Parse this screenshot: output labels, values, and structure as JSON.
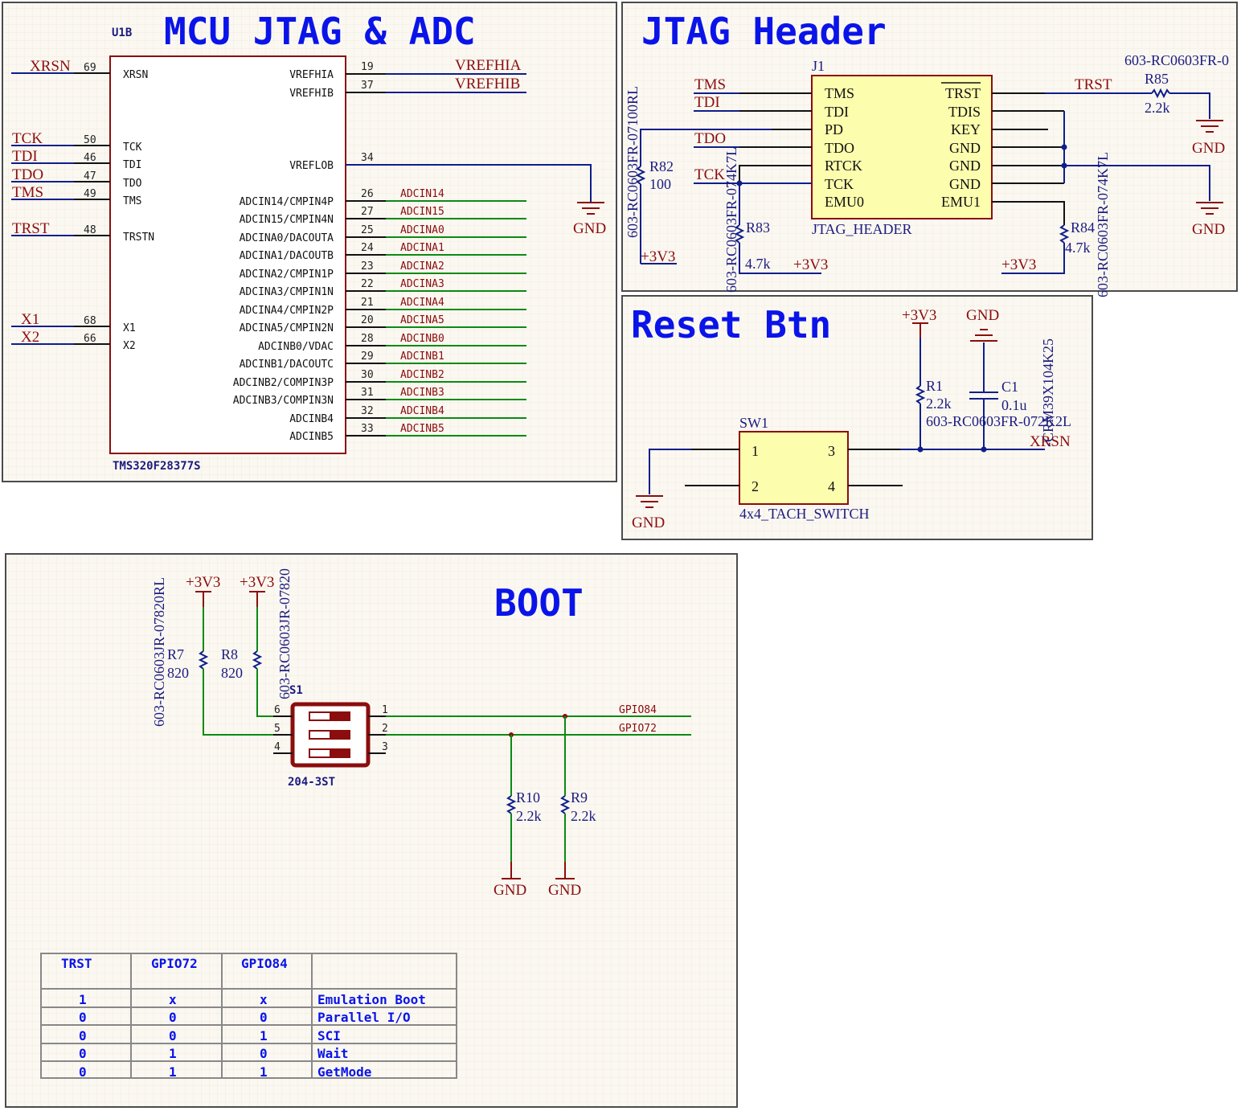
{
  "mcu_panel": {
    "title": "MCU JTAG & ADC",
    "ref": "U1B",
    "part": "TMS320F28377S",
    "left_pins": [
      {
        "net": "XRSN",
        "num": "69",
        "name": "XRSN"
      },
      {
        "net": "TCK",
        "num": "50",
        "name": "TCK"
      },
      {
        "net": "TDI",
        "num": "46",
        "name": "TDI"
      },
      {
        "net": "TDO",
        "num": "47",
        "name": "TDO"
      },
      {
        "net": "TMS",
        "num": "49",
        "name": "TMS"
      },
      {
        "net": "TRST",
        "num": "48",
        "name": "TRSTN"
      },
      {
        "net": "X1",
        "num": "68",
        "name": "X1"
      },
      {
        "net": "X2",
        "num": "66",
        "name": "X2"
      }
    ],
    "right_pins": [
      {
        "name": "VREFHIA",
        "num": "19",
        "net": "VREFHIA"
      },
      {
        "name": "VREFHIB",
        "num": "37",
        "net": "VREFHIB"
      },
      {
        "name": "VREFLOB",
        "num": "34",
        "net": ""
      },
      {
        "name": "ADCIN14/CMPIN4P",
        "num": "26",
        "net": "ADCIN14"
      },
      {
        "name": "ADCIN15/CMPIN4N",
        "num": "27",
        "net": "ADCIN15"
      },
      {
        "name": "ADCINA0/DACOUTA",
        "num": "25",
        "net": "ADCINA0"
      },
      {
        "name": "ADCINA1/DACOUTB",
        "num": "24",
        "net": "ADCINA1"
      },
      {
        "name": "ADCINA2/CMPIN1P",
        "num": "23",
        "net": "ADCINA2"
      },
      {
        "name": "ADCINA3/CMPIN1N",
        "num": "22",
        "net": "ADCINA3"
      },
      {
        "name": "ADCINA4/CMPIN2P",
        "num": "21",
        "net": "ADCINA4"
      },
      {
        "name": "ADCINA5/CMPIN2N",
        "num": "20",
        "net": "ADCINA5"
      },
      {
        "name": "ADCINB0/VDAC",
        "num": "28",
        "net": "ADCINB0"
      },
      {
        "name": "ADCINB1/DACOUTC",
        "num": "29",
        "net": "ADCINB1"
      },
      {
        "name": "ADCINB2/COMPIN3P",
        "num": "30",
        "net": "ADCINB2"
      },
      {
        "name": "ADCINB3/COMPIN3N",
        "num": "31",
        "net": "ADCINB3"
      },
      {
        "name": "ADCINB4",
        "num": "32",
        "net": "ADCINB4"
      },
      {
        "name": "ADCINB5",
        "num": "33",
        "net": "ADCINB5"
      }
    ],
    "gnd": "GND"
  },
  "jtag_panel": {
    "title": "JTAG Header",
    "ref": "J1",
    "part": "JTAG_HEADER",
    "left_pins": [
      "TMS",
      "TDI",
      "PD",
      "TDO",
      "RTCK",
      "TCK",
      "EMU0"
    ],
    "right_pins": [
      "TRST",
      "TDIS",
      "KEY",
      "GND",
      "GND",
      "GND",
      "EMU1"
    ],
    "nets_left": [
      "TMS",
      "TDI",
      "TDO",
      "TCK"
    ],
    "net_trst": "TRST",
    "r85": {
      "ref": "R85",
      "value": "2.2k",
      "part": "603-RC0603FR-0"
    },
    "r82": {
      "ref": "R82",
      "value": "100",
      "part": "603-RC0603FR-07100RL"
    },
    "r83": {
      "ref": "R83",
      "value": "4.7k",
      "part": "603-RC0603FR-074K7L"
    },
    "r84": {
      "ref": "R84",
      "value": "4.7k",
      "part": "603-RC0603FR-074K7L"
    },
    "power": "+3V3",
    "gnd": "GND"
  },
  "reset_panel": {
    "title": "Reset Btn",
    "sw_ref": "SW1",
    "sw_part": "4x4_TACH_SWITCH",
    "sw_pins": [
      "1",
      "2",
      "3",
      "4"
    ],
    "r1": {
      "ref": "R1",
      "value": "2.2k",
      "part": "603-RC0603FR-072K2L"
    },
    "c1": {
      "ref": "C1",
      "value": "0.1u",
      "part": "-CRM39X104K25"
    },
    "net": "XRSN",
    "power": "+3V3",
    "gnd": "GND"
  },
  "boot_panel": {
    "title": "BOOT",
    "s1_ref": "S1",
    "s1_part": "204-3ST",
    "s1_pins": [
      "1",
      "2",
      "3",
      "4",
      "5",
      "6"
    ],
    "r7": {
      "ref": "R7",
      "value": "820",
      "part": "603-RC0603JR-07820RL"
    },
    "r8": {
      "ref": "R8",
      "value": "820",
      "part": "603-RC0603JR-07820"
    },
    "r10": {
      "ref": "R10",
      "value": "2.2k"
    },
    "r9": {
      "ref": "R9",
      "value": "2.2k"
    },
    "nets": [
      "GPIO84",
      "GPIO72"
    ],
    "power": "+3V3",
    "gnd": "GND",
    "table": {
      "headers": [
        "TRST",
        "GPIO72",
        "GPIO84",
        ""
      ],
      "rows": [
        [
          "1",
          "x",
          "x",
          "Emulation Boot"
        ],
        [
          "0",
          "0",
          "0",
          "Parallel I/O"
        ],
        [
          "0",
          "0",
          "1",
          "SCI"
        ],
        [
          "0",
          "1",
          "0",
          "Wait"
        ],
        [
          "0",
          "1",
          "1",
          "GetMode"
        ]
      ]
    }
  }
}
